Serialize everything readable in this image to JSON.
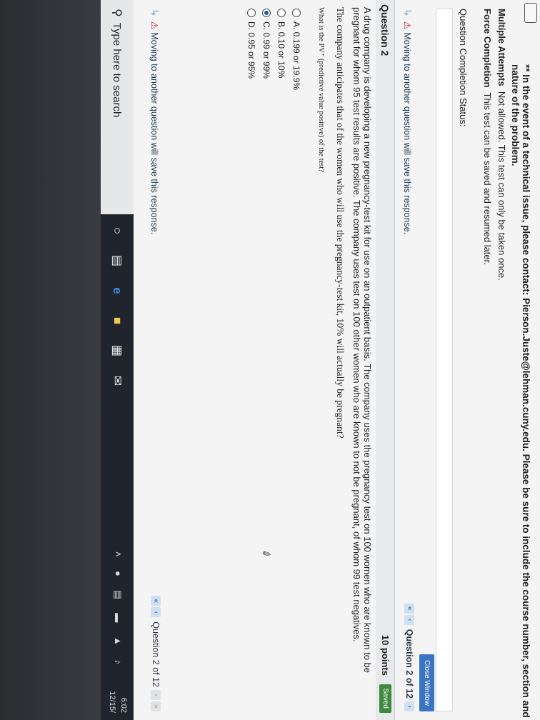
{
  "notice": "** In the event of a technical issue, please contact: Pierson.Juste@lehman.cuny.edu. Please be sure to include the course number, section and nature of the problem.",
  "info": {
    "multiple_attempts_label": "Multiple Attempts",
    "multiple_attempts_value": "Not allowed. This test can only be taken once.",
    "force_completion_label": "Force Completion",
    "force_completion_value": "This test can be saved and resumed later."
  },
  "status_label": "Question Completion Status:",
  "close_window_label": "Close Window",
  "warning_text": "Moving to another question will save this response.",
  "nav_label": "Question 2 of 12",
  "question": {
    "title": "Question 2",
    "points": "10 points",
    "saved": "Saved",
    "prompt": "A drug company is developing a new pregnancy-test kit for use on an outpatient basis. The company uses the pregnancy test on 100 women who are known to be pregnant for whom 95 test results are positive. The company uses test on 100 other women who are known to not be pregnant, of whom 99 test negatives.",
    "scenario": "The company anticipates that of the women who will use the pregnancy-test kit, 10% will actually be pregnant?",
    "ask": "What is the PV⁺ (predictive value positive) of the test?",
    "choices": [
      {
        "label": "A. 0.199 or 19.9%",
        "selected": false
      },
      {
        "label": "B. 0.10 or 10%",
        "selected": false
      },
      {
        "label": "C. 0.99 or 99%",
        "selected": true
      },
      {
        "label": "D. 0.95 or 95%",
        "selected": false
      }
    ]
  },
  "taskbar": {
    "search_placeholder": "Type here to search",
    "icons": [
      "cortana-icon",
      "task-view-icon",
      "edge-icon",
      "file-explorer-icon",
      "store-icon",
      "mail-icon"
    ],
    "time": "6:02",
    "date": "12/15/"
  }
}
